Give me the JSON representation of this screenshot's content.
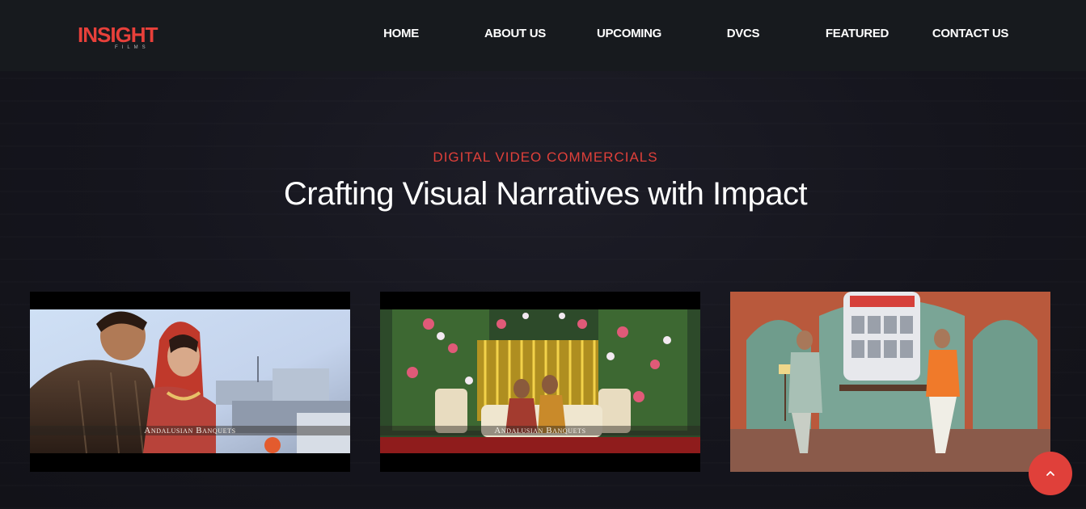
{
  "brand": {
    "logo_text": "INSIGHT",
    "logo_subtext": "FILMS",
    "accent": "#e0403a"
  },
  "nav": {
    "items": [
      {
        "label": "HOME"
      },
      {
        "label": "ABOUT US"
      },
      {
        "label": "UPCOMING"
      },
      {
        "label": "DVCS"
      },
      {
        "label": "FEATURED"
      },
      {
        "label": "CONTACT US"
      }
    ]
  },
  "section": {
    "eyebrow": "DIGITAL VIDEO COMMERCIALS",
    "title": "Crafting Visual Narratives with Impact"
  },
  "videos": [
    {
      "caption": "Andalusian Banquets"
    },
    {
      "caption": "Andalusian Banquets"
    },
    {
      "caption": ""
    }
  ],
  "scroll_top": {
    "icon": "chevron-up-icon"
  }
}
